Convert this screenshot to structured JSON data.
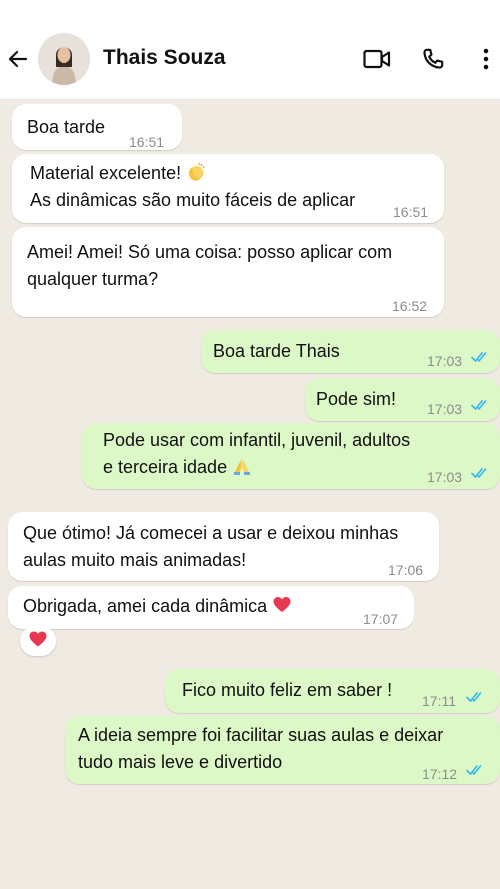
{
  "header": {
    "contact_name": "Thais Souza"
  },
  "messages": [
    {
      "text": "Boa tarde",
      "time": "16:51",
      "direction": "incoming"
    },
    {
      "line1": "Material excelente!",
      "line2": "As dinâmicas são muito fáceis de aplicar",
      "time": "16:51",
      "direction": "incoming",
      "emoji": "clapping-hands"
    },
    {
      "line1": "Amei! Amei! Só uma coisa: posso aplicar com",
      "line2": "qualquer turma?",
      "time": "16:52",
      "direction": "incoming"
    },
    {
      "text": "Boa tarde Thais",
      "time": "17:03",
      "direction": "outgoing",
      "status": "read"
    },
    {
      "text": "Pode sim!",
      "time": "17:03",
      "direction": "outgoing",
      "status": "read"
    },
    {
      "line1": "Pode usar com infantil, juvenil, adultos",
      "line2": "e terceira idade",
      "time": "17:03",
      "direction": "outgoing",
      "status": "read",
      "emoji": "folded-hands"
    },
    {
      "line1": "Que ótimo! Já comecei a usar e deixou minhas",
      "line2": "aulas muito mais animadas!",
      "time": "17:06",
      "direction": "incoming"
    },
    {
      "text": "Obrigada, amei cada dinâmica",
      "time": "17:07",
      "direction": "incoming",
      "emoji": "red-heart",
      "reaction": "red-heart"
    },
    {
      "text": "Fico muito feliz em saber !",
      "time": "17:11",
      "direction": "outgoing",
      "status": "read"
    },
    {
      "line1": "A ideia sempre foi facilitar suas aulas e deixar",
      "line2": "tudo mais leve e divertido",
      "time": "17:12",
      "direction": "outgoing",
      "status": "read"
    }
  ],
  "colors": {
    "incoming_bubble": "#ffffff",
    "outgoing_bubble": "#dcf8c6",
    "read_ticks": "#34b7f1",
    "background": "#efeae2"
  }
}
